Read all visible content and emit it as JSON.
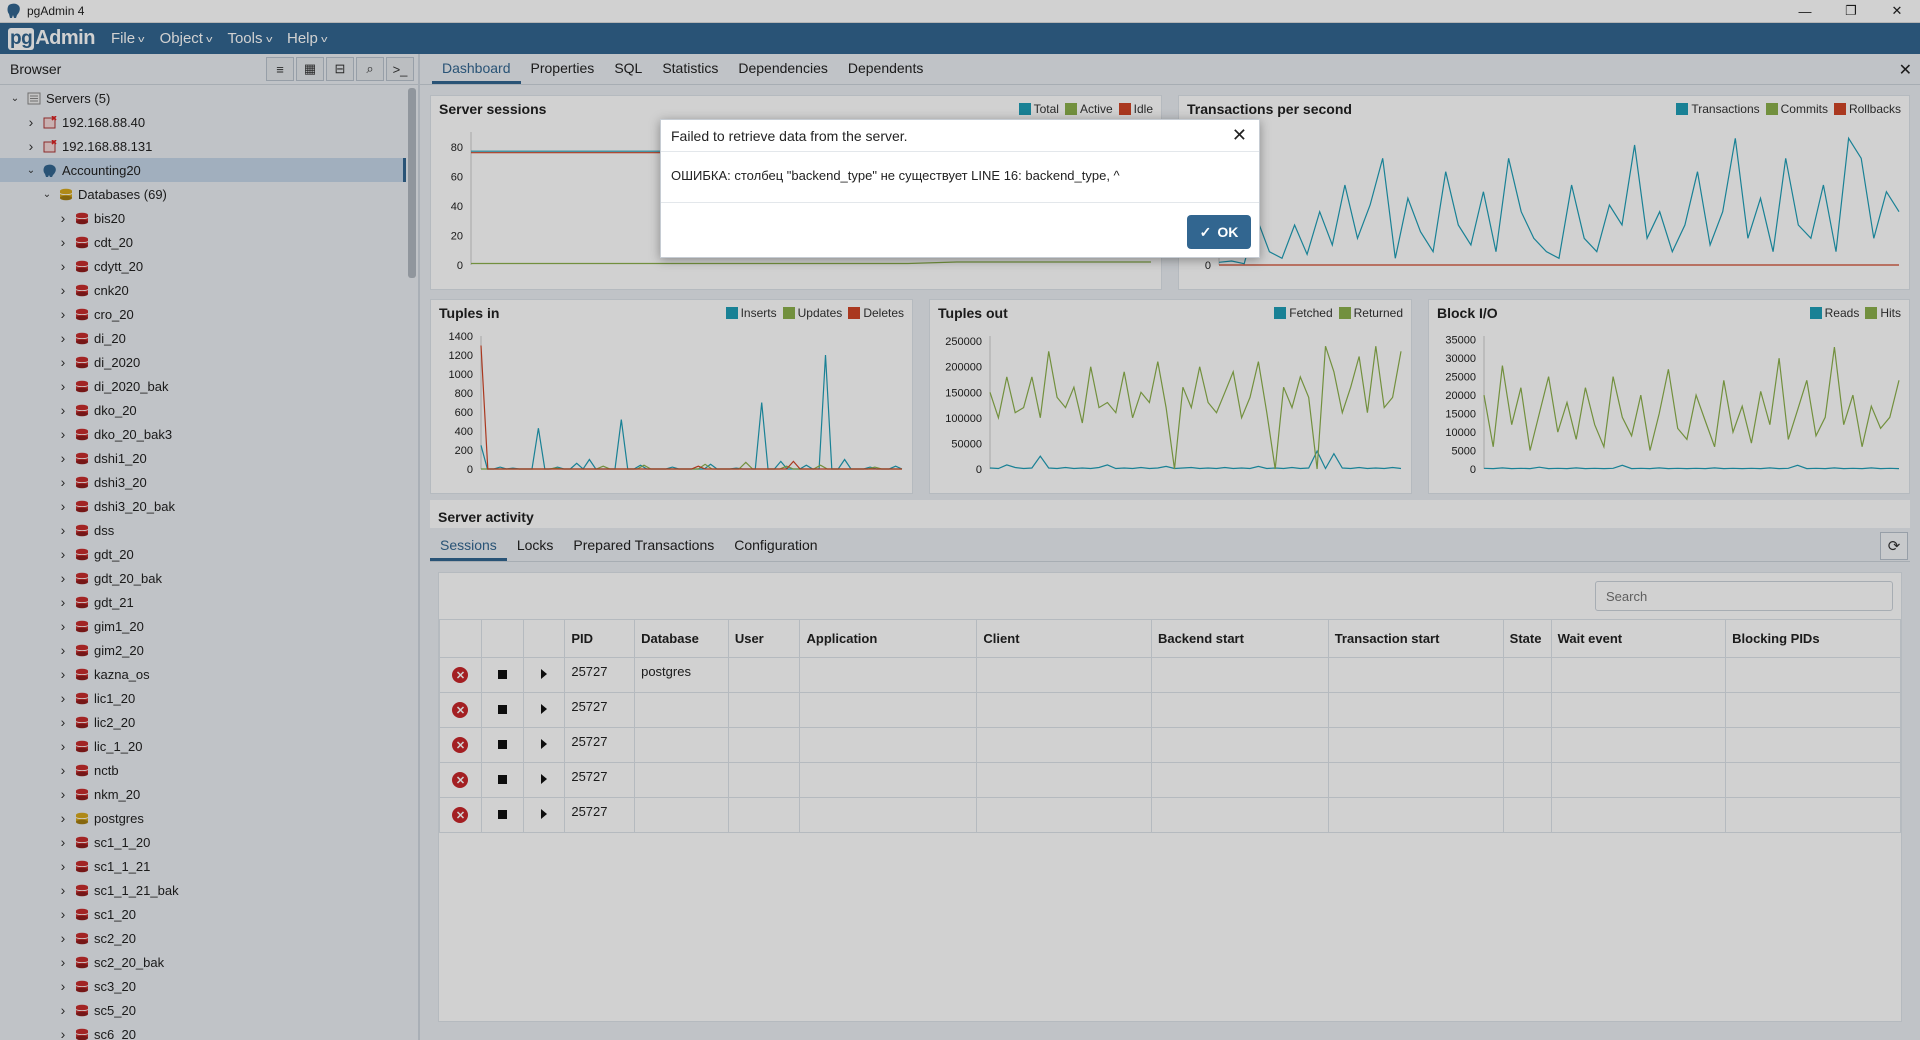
{
  "window": {
    "title": "pgAdmin 4",
    "min": "—",
    "restore": "❐",
    "close": "✕"
  },
  "menubar": {
    "logo_pg": "pg",
    "logo_admin": "Admin",
    "menus": [
      "File",
      "Object",
      "Tools",
      "Help"
    ]
  },
  "browser": {
    "title": "Browser"
  },
  "tree": {
    "servers": "Servers (5)",
    "server1": "192.168.88.40",
    "server2": "192.168.88.131",
    "server3": "Accounting20",
    "databases": "Databases (69)",
    "dbs": [
      "bis20",
      "cdt_20",
      "cdytt_20",
      "cnk20",
      "cro_20",
      "di_20",
      "di_2020",
      "di_2020_bak",
      "dko_20",
      "dko_20_bak3",
      "dshi1_20",
      "dshi3_20",
      "dshi3_20_bak",
      "dss",
      "gdt_20",
      "gdt_20_bak",
      "gdt_21",
      "gim1_20",
      "gim2_20",
      "kazna_os",
      "lic1_20",
      "lic2_20",
      "lic_1_20",
      "nctb",
      "nkm_20",
      "postgres",
      "sc1_1_20",
      "sc1_1_21",
      "sc1_1_21_bak",
      "sc1_20",
      "sc2_20",
      "sc2_20_bak",
      "sc3_20",
      "sc5_20",
      "sc6_20"
    ]
  },
  "tabs": [
    "Dashboard",
    "Properties",
    "SQL",
    "Statistics",
    "Dependencies",
    "Dependents"
  ],
  "panels": {
    "server_sessions": {
      "title": "Server sessions",
      "legend": [
        "Total",
        "Active",
        "Idle"
      ]
    },
    "tps": {
      "title": "Transactions per second",
      "legend": [
        "Transactions",
        "Commits",
        "Rollbacks"
      ]
    },
    "tuples_in": {
      "title": "Tuples in",
      "legend": [
        "Inserts",
        "Updates",
        "Deletes"
      ]
    },
    "tuples_out": {
      "title": "Tuples out",
      "legend": [
        "Fetched",
        "Returned"
      ]
    },
    "block_io": {
      "title": "Block I/O",
      "legend": [
        "Reads",
        "Hits"
      ]
    }
  },
  "colors": {
    "blue": "#1f9eb6",
    "green": "#8cb04c",
    "red": "#d04527",
    "accent": "#326690"
  },
  "chart_data": [
    {
      "type": "line",
      "title": "Server sessions",
      "yticks": [
        "80",
        "60",
        "40",
        "20",
        "0"
      ],
      "ylim": [
        0,
        90
      ],
      "series": [
        {
          "name": "Total",
          "values": [
            77,
            77,
            77,
            77,
            77,
            77,
            77,
            77,
            77,
            78,
            82,
            82,
            82,
            82,
            82
          ]
        },
        {
          "name": "Active",
          "values": [
            1,
            1,
            1,
            1,
            1,
            1,
            1,
            1,
            1,
            1,
            2,
            2,
            2,
            2,
            2
          ]
        },
        {
          "name": "Idle",
          "values": [
            76,
            76,
            76,
            76,
            76,
            76,
            76,
            76,
            76,
            77,
            80,
            80,
            80,
            80,
            80
          ]
        }
      ]
    },
    {
      "type": "line",
      "title": "Transactions per second",
      "yticks": [
        "0"
      ],
      "series": [
        {
          "name": "Transactions",
          "values": [
            2,
            3,
            1,
            35,
            10,
            5,
            30,
            8,
            40,
            15,
            60,
            20,
            45,
            80,
            5,
            50,
            25,
            10,
            70,
            30,
            15,
            55,
            10,
            80,
            40,
            20,
            10,
            5,
            60,
            20,
            10,
            45,
            30,
            90,
            20,
            40,
            10,
            30,
            70,
            15,
            40,
            95,
            20,
            50,
            10,
            80,
            30,
            20,
            60,
            10,
            95,
            80,
            20,
            55,
            40
          ]
        },
        {
          "name": "Rollbacks",
          "values": [
            0,
            0,
            0,
            0,
            0,
            0,
            0,
            0,
            0,
            0
          ]
        }
      ]
    },
    {
      "type": "line",
      "title": "Tuples in",
      "yticks": [
        "1400",
        "1200",
        "1000",
        "800",
        "600",
        "400",
        "200",
        "0"
      ],
      "ylim": [
        0,
        1400
      ],
      "series": [
        {
          "name": "Inserts",
          "values": [
            250,
            0,
            0,
            20,
            0,
            10,
            0,
            0,
            0,
            430,
            0,
            0,
            20,
            0,
            0,
            60,
            0,
            100,
            0,
            0,
            0,
            0,
            520,
            0,
            0,
            40,
            0,
            0,
            0,
            0,
            20,
            0,
            0,
            0,
            0,
            0,
            50,
            0,
            0,
            0,
            10,
            0,
            0,
            0,
            700,
            0,
            0,
            80,
            0,
            0,
            0,
            40,
            0,
            0,
            1200,
            0,
            0,
            100,
            0,
            0,
            0,
            20,
            0,
            0,
            0,
            30,
            0
          ]
        },
        {
          "name": "Updates",
          "values": [
            0,
            0,
            0,
            0,
            0,
            0,
            0,
            0,
            0,
            0,
            0,
            10,
            0,
            0,
            0,
            0,
            0,
            0,
            30,
            0,
            0,
            0,
            0,
            0,
            40,
            0,
            0,
            0,
            0,
            0,
            0,
            0,
            0,
            50,
            0,
            0,
            0,
            0,
            0,
            70,
            0,
            0,
            0,
            0,
            0,
            30,
            0,
            0,
            0,
            0,
            40,
            0,
            0,
            0,
            0,
            0,
            0,
            0,
            20,
            0,
            0,
            0,
            0
          ]
        },
        {
          "name": "Deletes",
          "values": [
            1300,
            0,
            0,
            0,
            0,
            0,
            0,
            0,
            0,
            0,
            0,
            0,
            0,
            0,
            0,
            0,
            0,
            0,
            0,
            0,
            0,
            0,
            0,
            0,
            0,
            0,
            0,
            0,
            0,
            0,
            0,
            0,
            30,
            0,
            0,
            0,
            0,
            0,
            0,
            0,
            0,
            0,
            0,
            0,
            0,
            0,
            80,
            0,
            0,
            0,
            0,
            0,
            0,
            0,
            0,
            0,
            0,
            0,
            0,
            0,
            0,
            0,
            0
          ]
        }
      ]
    },
    {
      "type": "line",
      "title": "Tuples out",
      "yticks": [
        "250000",
        "200000",
        "150000",
        "100000",
        "50000",
        "0"
      ],
      "ylim": [
        0,
        260000
      ],
      "series": [
        {
          "name": "Fetched",
          "values": [
            2000,
            1000,
            8000,
            3000,
            1000,
            2000,
            25000,
            2000,
            1000,
            3000,
            1000,
            2000,
            1000,
            3000,
            8000,
            1000,
            2000,
            1000,
            3000,
            1000,
            2000,
            5000,
            1000,
            2000,
            3000,
            1000,
            2000,
            1000,
            3000,
            1000,
            2000,
            1000,
            5000,
            1000,
            2000,
            1000,
            3000,
            1000,
            2000,
            35000,
            1000,
            30000,
            2000,
            1000,
            3000,
            1000,
            2000,
            1000,
            3000,
            1000
          ]
        },
        {
          "name": "Returned",
          "values": [
            150000,
            100000,
            180000,
            110000,
            120000,
            180000,
            100000,
            230000,
            140000,
            120000,
            160000,
            90000,
            200000,
            120000,
            130000,
            110000,
            190000,
            100000,
            150000,
            130000,
            210000,
            120000,
            0,
            160000,
            120000,
            200000,
            130000,
            110000,
            150000,
            190000,
            100000,
            140000,
            210000,
            110000,
            0,
            160000,
            120000,
            180000,
            140000,
            0,
            240000,
            190000,
            110000,
            160000,
            220000,
            110000,
            240000,
            120000,
            140000,
            230000
          ]
        }
      ]
    },
    {
      "type": "line",
      "title": "Block I/O",
      "yticks": [
        "35000",
        "30000",
        "25000",
        "20000",
        "15000",
        "10000",
        "5000",
        "0"
      ],
      "ylim": [
        0,
        36000
      ],
      "series": [
        {
          "name": "Reads",
          "values": [
            200,
            100,
            300,
            100,
            200,
            100,
            500,
            100,
            200,
            100,
            300,
            100,
            200,
            100,
            200,
            1000,
            100,
            200,
            100,
            300,
            100,
            200,
            100,
            200,
            100,
            300,
            100,
            200,
            100,
            200,
            100,
            300,
            100,
            200,
            1000,
            100,
            200,
            100,
            300,
            100,
            200,
            100,
            300,
            100,
            200,
            100
          ]
        },
        {
          "name": "Hits",
          "values": [
            20000,
            6000,
            28000,
            12000,
            22000,
            5000,
            15000,
            25000,
            10000,
            18000,
            8000,
            22000,
            12000,
            6000,
            25000,
            14000,
            9000,
            20000,
            5000,
            15000,
            27000,
            11000,
            8000,
            20000,
            13000,
            6000,
            24000,
            10000,
            17000,
            7000,
            21000,
            12000,
            30000,
            8000,
            16000,
            24000,
            9000,
            14000,
            33000,
            12000,
            20000,
            6000,
            17000,
            11000,
            14000,
            24000
          ]
        }
      ]
    }
  ],
  "dialog": {
    "title": "Failed to retrieve data from the server.",
    "message": "ОШИБКА: столбец \"backend_type\" не существует LINE 16: backend_type, ^",
    "ok": "OK"
  },
  "activity": {
    "title": "Server activity",
    "tabs": [
      "Sessions",
      "Locks",
      "Prepared Transactions",
      "Configuration"
    ],
    "search_placeholder": "Search",
    "columns": [
      "PID",
      "Database",
      "User",
      "Application",
      "Client",
      "Backend start",
      "Transaction start",
      "State",
      "Wait event",
      "Blocking PIDs"
    ],
    "rows": [
      {
        "pid": "25727",
        "database": "postgres"
      },
      {
        "pid": "25727",
        "database": ""
      },
      {
        "pid": "25727",
        "database": ""
      },
      {
        "pid": "25727",
        "database": ""
      },
      {
        "pid": "25727",
        "database": ""
      }
    ]
  }
}
